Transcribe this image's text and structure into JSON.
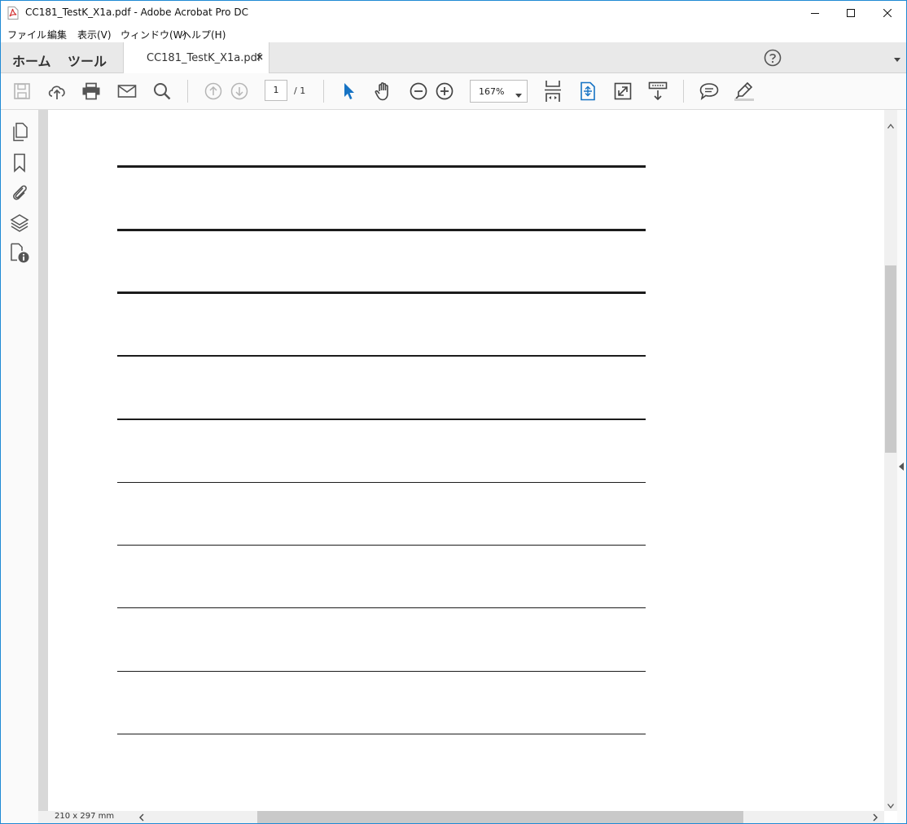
{
  "window": {
    "title": "CC181_TestK_X1a.pdf - Adobe Acrobat Pro DC"
  },
  "menu": {
    "items": [
      {
        "label": "ファイル"
      },
      {
        "label": "編集"
      },
      {
        "label": "表示(V)"
      },
      {
        "label": "ウィンドウ(W)"
      },
      {
        "label": "ヘルプ(H)"
      }
    ]
  },
  "tabs": {
    "home_label": "ホーム",
    "tools_label": "ツール",
    "document_tab_label": "CC181_TestK_X1a.pdf"
  },
  "toolbar": {
    "current_page": "1",
    "page_total": "/ 1",
    "zoom": "167%"
  },
  "status": {
    "page_size": "210 x 297 mm"
  },
  "colors": {
    "accent": "#1f8ad4",
    "selection_tool": "#1673c4",
    "pdf_icon_red": "#d32f2f"
  },
  "icons": {
    "window": [
      "pdf-file-icon",
      "minimize-icon",
      "maximize-icon",
      "close-icon"
    ],
    "toolbar": [
      "save-icon",
      "upload-cloud-icon",
      "print-icon",
      "email-icon",
      "search-icon",
      "page-up-icon",
      "page-down-icon",
      "select-arrow-icon",
      "hand-icon",
      "zoom-out-icon",
      "zoom-in-icon",
      "fit-page-icon",
      "scroll-mode-icon",
      "full-screen-icon",
      "read-mode-icon",
      "comment-icon",
      "highlight-icon"
    ],
    "left_pane": [
      "page-thumbnails-icon",
      "bookmark-icon",
      "attachment-icon",
      "layers-icon",
      "document-info-icon"
    ]
  }
}
